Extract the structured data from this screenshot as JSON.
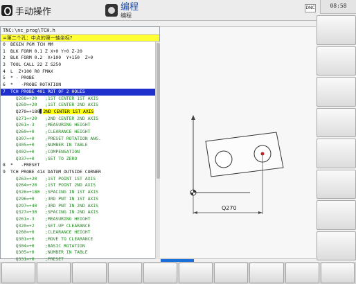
{
  "header": {
    "mode_left_label": "手动操作",
    "mode_right_title": "编程",
    "mode_right_sub": "编程",
    "dnc_label": "DNC",
    "clock": "08:58"
  },
  "program": {
    "path": "TNC:\\nc_prog\\TCH.h",
    "info": "=第二个孔：中点的第一轴坐标?",
    "lines": [
      {
        "num": "0",
        "text": "BEGIN PGM TCH MM",
        "kind": "normal"
      },
      {
        "num": "1",
        "text": "BLK FORM 0.1 Z X+0 Y+0 Z-20",
        "kind": "normal"
      },
      {
        "num": "2",
        "text": "BLK FORM 0.2  X+100  Y+150  Z+0",
        "kind": "normal"
      },
      {
        "num": "3",
        "text": "TOOL CALL 22 Z S250",
        "kind": "normal"
      },
      {
        "num": "4",
        "text": "L  Z+100 R0 FMAX",
        "kind": "normal"
      },
      {
        "num": "5",
        "text": "* - PROBE",
        "kind": "normal"
      },
      {
        "num": "6",
        "text": "*   -PROBE ROTATION",
        "kind": "normal"
      },
      {
        "num": "7",
        "text": "TCH PROBE 401 ROT OF 2 HOLES",
        "kind": "active"
      },
      {
        "num": "",
        "text": "  Q268=+20   ;1ST CENTER 1ST AXIS",
        "kind": "comment"
      },
      {
        "num": "",
        "text": "  Q269=+20   ;1ST CENTER 2ND AXIS",
        "kind": "comment"
      },
      {
        "num": "",
        "text": "  Q270=+180",
        "hl": "2ND CENTER 1ST AXIS",
        "kind": "edit"
      },
      {
        "num": "",
        "text": "  Q271=+20   ;2ND CENTER 2ND AXIS",
        "kind": "comment"
      },
      {
        "num": "",
        "text": "  Q261=-3    ;MEASURING HEIGHT",
        "kind": "comment"
      },
      {
        "num": "",
        "text": "  Q260=+0    ;CLEARANCE HEIGHT",
        "kind": "comment"
      },
      {
        "num": "",
        "text": "  Q307=+0    ;PRESET ROTATION ANG.",
        "kind": "comment"
      },
      {
        "num": "",
        "text": "  Q305=+0    ;NUMBER IN TABLE",
        "kind": "comment"
      },
      {
        "num": "",
        "text": "  Q402=+0    ;COMPENSATION",
        "kind": "comment"
      },
      {
        "num": "",
        "text": "  Q337=+0    ;SET TO ZERO",
        "kind": "comment"
      },
      {
        "num": "8",
        "text": "*   -PRESET",
        "kind": "normal"
      },
      {
        "num": "9",
        "text": "TCH PROBE 414 DATUM OUTSIDE CORNER",
        "kind": "normal"
      },
      {
        "num": "",
        "text": "  Q263=+20   ;1ST POINT 1ST AXIS",
        "kind": "comment"
      },
      {
        "num": "",
        "text": "  Q264=+20   ;1ST POINT 2ND AXIS",
        "kind": "comment"
      },
      {
        "num": "",
        "text": "  Q326=+180  ;SPACING IN 1ST AXIS",
        "kind": "comment"
      },
      {
        "num": "",
        "text": "  Q296=+0    ;3RD PNT IN 1ST AXIS",
        "kind": "comment"
      },
      {
        "num": "",
        "text": "  Q297=+40   ;3RD PNT IN 2ND AXIS",
        "kind": "comment"
      },
      {
        "num": "",
        "text": "  Q327=+30   ;SPACING IN 2ND AXIS",
        "kind": "comment"
      },
      {
        "num": "",
        "text": "  Q261=-3    ;MEASURING HEIGHT",
        "kind": "comment"
      },
      {
        "num": "",
        "text": "  Q320=+2    ;SET-UP CLEARANCE",
        "kind": "comment"
      },
      {
        "num": "",
        "text": "  Q260=+0    ;CLEARANCE HEIGHT",
        "kind": "comment"
      },
      {
        "num": "",
        "text": "  Q301=+0    ;MOVE TO CLEARANCE",
        "kind": "comment"
      },
      {
        "num": "",
        "text": "  Q304=+0    ;BASIC ROTATION",
        "kind": "comment"
      },
      {
        "num": "",
        "text": "  Q305=+0    ;NUMBER IN TABLE",
        "kind": "comment"
      },
      {
        "num": "",
        "text": "  Q331=+0    ;PRESET",
        "kind": "comment"
      }
    ]
  },
  "graphic": {
    "dimension_label": "Q270"
  },
  "softkeys": {
    "vertical_count": 8,
    "horizontal_count": 10
  },
  "colors": {
    "active_line": "#1f2fcc",
    "comment": "#1b8a1b",
    "info_bar": "#ffff33"
  }
}
